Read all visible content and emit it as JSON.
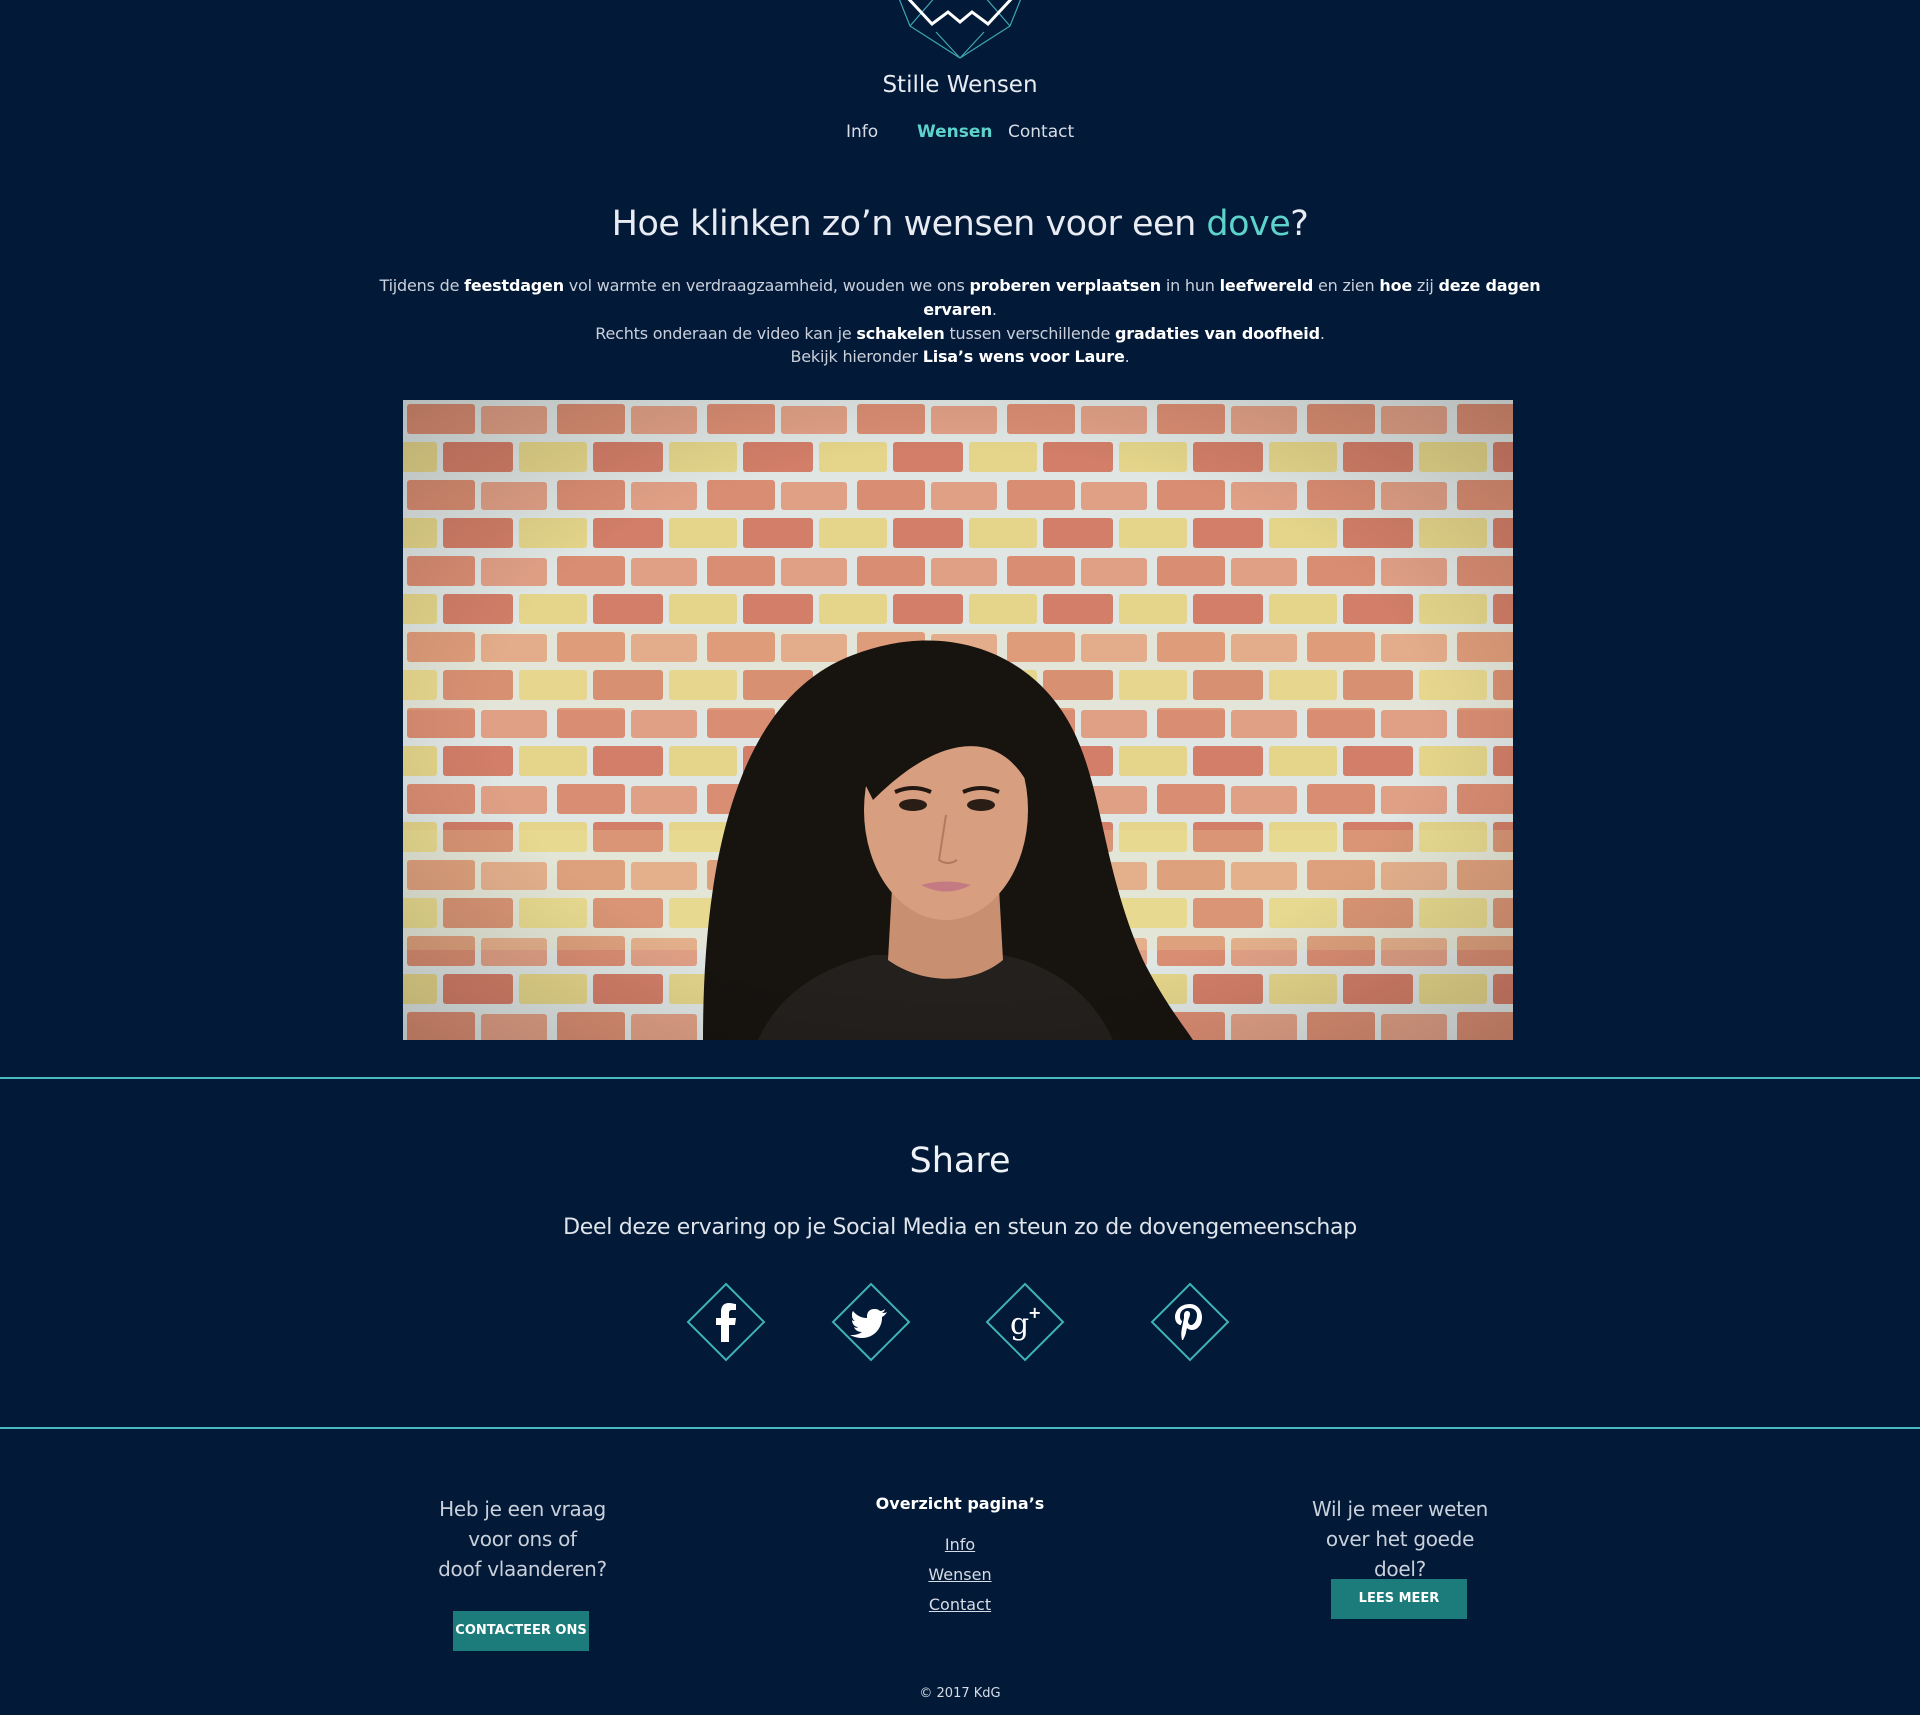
{
  "brand": {
    "name": "Stille Wensen"
  },
  "nav": {
    "items": [
      {
        "label": "Info"
      },
      {
        "label": "Wensen"
      },
      {
        "label": "Contact"
      }
    ]
  },
  "hero": {
    "heading_prefix": "Hoe klinken zo’n wensen voor een ",
    "heading_highlight": "dove",
    "heading_suffix": "?",
    "intro": {
      "p1": "Tijdens de ",
      "b1": "feestdagen",
      "p2": " vol warmte en verdraagzaamheid, wouden we ons ",
      "b2": "proberen verplaatsen",
      "p3": " in hun ",
      "b3": "leefwereld",
      "p4": " en zien ",
      "b4": "hoe",
      "p5": " zij ",
      "b5": "deze dagen ervaren",
      "p6": ".",
      "p7": "Rechts onderaan de video kan je ",
      "b6": "schakelen",
      "p8": " tussen verschillende ",
      "b7": "gradaties van doofheid",
      "p9": "."
    },
    "watch": {
      "prefix": "Bekijk hieronder ",
      "bold": "Lisa’s wens voor Laure",
      "suffix": "."
    }
  },
  "share": {
    "title": "Share",
    "text": "Deel deze ervaring op je Social Media en steun zo de dovengemeenschap",
    "icons": [
      "facebook-icon",
      "twitter-icon",
      "google-plus-icon",
      "pinterest-icon"
    ]
  },
  "footer": {
    "question": {
      "line1": "Heb je een vraag",
      "line2": "voor ons of",
      "line3": "doof vlaanderen?"
    },
    "contact_button": "CONTACTEER ONS",
    "overview_title": "Overzicht pagina’s",
    "links": [
      "Info",
      "Wensen",
      "Contact"
    ],
    "more": {
      "line1": "Wil je meer weten",
      "line2": "over het goede doel?"
    },
    "more_button": "LEES MEER",
    "copyright": "© 2017 KdG"
  },
  "colors": {
    "background": "#021937",
    "accent": "#5ed3cb",
    "button": "#1c7c7b"
  }
}
